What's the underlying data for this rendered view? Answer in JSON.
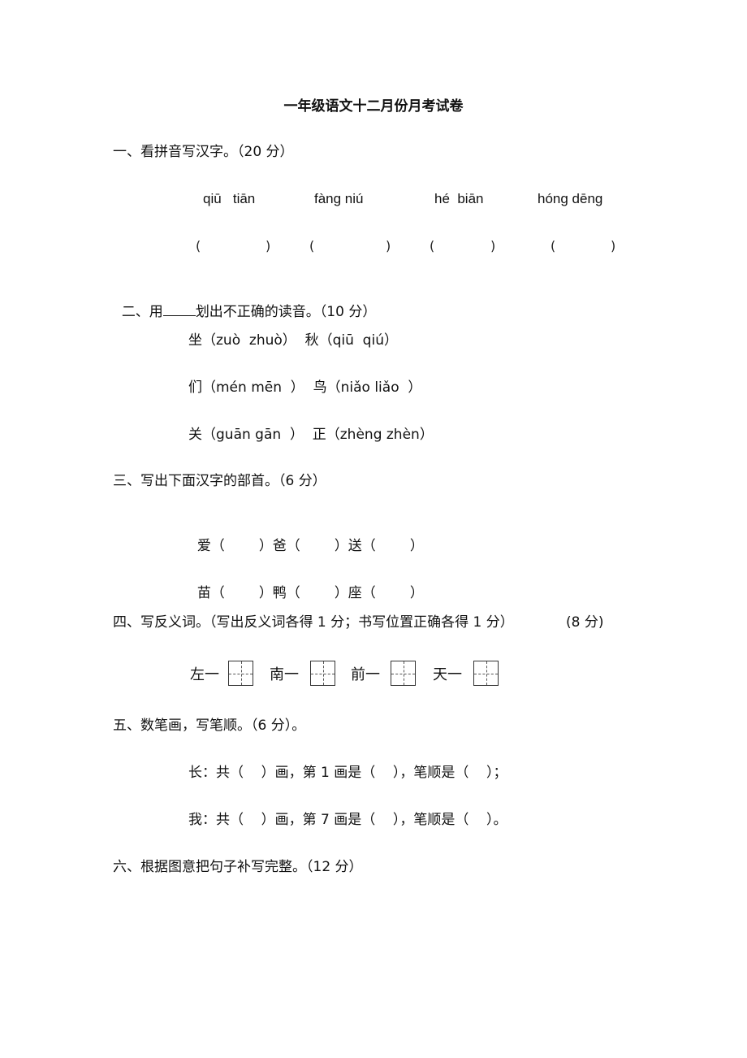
{
  "title": "一年级语文十二月份月考试卷",
  "sections": [
    {
      "heading": "一、看拼音写汉字。（20 分）",
      "pinyin": [
        "qiū   tiān",
        "fàng niú",
        "hé  biān",
        "hóng dēng"
      ],
      "blanks": [
        "(",
        ")",
        "(",
        ")",
        "(",
        ")",
        "(",
        ")"
      ]
    },
    {
      "heading_prefix": "二、用",
      "heading_suffix": "划出不正确的读音。（10 分）",
      "lines": [
        "坐（zuò  zhuò）  秋（qiū  qiú）",
        "们（mén mēn  ）  鸟（niǎo liǎo  ）",
        "关（guān gān  ）  正（zhèng zhèn）"
      ]
    },
    {
      "heading": "三、写出下面汉字的部首。（6 分）",
      "rows": [
        [
          "爱（",
          "）爸（",
          "）送（",
          "）"
        ],
        [
          "苗（",
          "）鸭（",
          "）座（",
          "）"
        ]
      ]
    },
    {
      "heading": "四、写反义词。（写出反义词各得 1 分；书写位置正确各得 1 分）",
      "score": "(8 分)",
      "items": [
        "左一",
        "南一",
        "前一",
        "天一"
      ]
    },
    {
      "heading": "五、数笔画，写笔顺。（6 分）。",
      "lines": [
        "长：共（    ）画，第 1 画是（    ），笔顺是（    ）；",
        "我：共（    ）画，第 7 画是（    ），笔顺是（    ）。"
      ]
    },
    {
      "heading": "六、根据图意把句子补写完整。（12 分）"
    }
  ]
}
